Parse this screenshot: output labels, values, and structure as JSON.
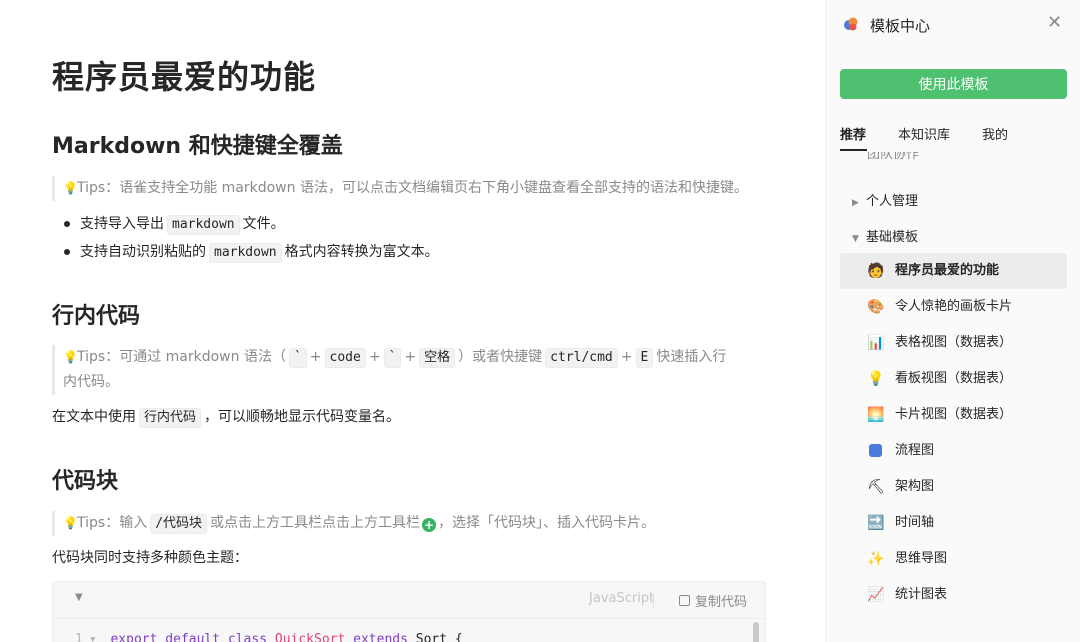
{
  "doc": {
    "title": "程序员最爱的功能",
    "sections": {
      "markdown": {
        "heading": "Markdown 和快捷键全覆盖",
        "tip": "Tips：语雀支持全功能 markdown 语法，可以点击文档编辑页右下角小键盘查看全部支持的语法和快捷键。",
        "bullets": [
          {
            "pre": "支持导入导出",
            "code": "markdown",
            "post": "文件。"
          },
          {
            "pre": "支持自动识别粘贴的",
            "code": "markdown",
            "post": "格式内容转换为富文本。"
          }
        ]
      },
      "inline_code": {
        "heading": "行内代码",
        "tip_parts": {
          "p1": "Tips：可通过 markdown 语法（",
          "code1": "`",
          "plus": "+",
          "code2": "code",
          "code3": "`",
          "code4": "空格",
          "p2": "）或者快捷键",
          "code5": "ctrl/cmd",
          "code6": "E",
          "p3": "快速插入行",
          "p4": "内代码。"
        },
        "para_pre": "在文本中使用",
        "para_code": "行内代码",
        "para_post": "，可以顺畅地显示代码变量名。"
      },
      "code_block": {
        "heading": "代码块",
        "tip_pre": "Tips：输入",
        "tip_code": "/代码块",
        "tip_mid": "或点击上方工具栏点击上方工具栏",
        "tip_post": "，选择「代码块」、插入代码卡片。",
        "para": "代码块同时支持多种颜色主题：",
        "language": "JavaScript",
        "copy_label": "复制代码",
        "line_number": "1",
        "code_tokens": {
          "kw1": "export",
          "kw2": "default",
          "kw3": "class",
          "cls1": "QuickSort",
          "kw4": "extends",
          "rest": "Sort {"
        }
      }
    }
  },
  "panel": {
    "title": "模板中心",
    "use_button": "使用此模板",
    "tabs": [
      "推荐",
      "本知识库",
      "我的"
    ],
    "cut_item": "团队协作",
    "groups": [
      {
        "label": "个人管理",
        "expanded": false
      },
      {
        "label": "基础模板",
        "expanded": true
      }
    ],
    "items": [
      {
        "label": "程序员最爱的功能",
        "icon": "programmer-emoji",
        "selected": true
      },
      {
        "label": "令人惊艳的画板卡片",
        "icon": "palette-icon"
      },
      {
        "label": "表格视图（数据表）",
        "icon": "bar-chart-icon"
      },
      {
        "label": "看板视图（数据表）",
        "icon": "lightbulb-icon"
      },
      {
        "label": "卡片视图（数据表）",
        "icon": "picture-icon"
      },
      {
        "label": "流程图",
        "icon": "flow-icon"
      },
      {
        "label": "架构图",
        "icon": "architecture-icon"
      },
      {
        "label": "时间轴",
        "icon": "soon-arrow-icon"
      },
      {
        "label": "思维导图",
        "icon": "sparkles-icon"
      },
      {
        "label": "统计图表",
        "icon": "line-chart-icon"
      }
    ]
  },
  "colors": {
    "accent_green": "#4fbf70",
    "selected_bg": "#ececec",
    "keyword_purple": "#7f3fbf",
    "class_pink": "#d9467c"
  }
}
